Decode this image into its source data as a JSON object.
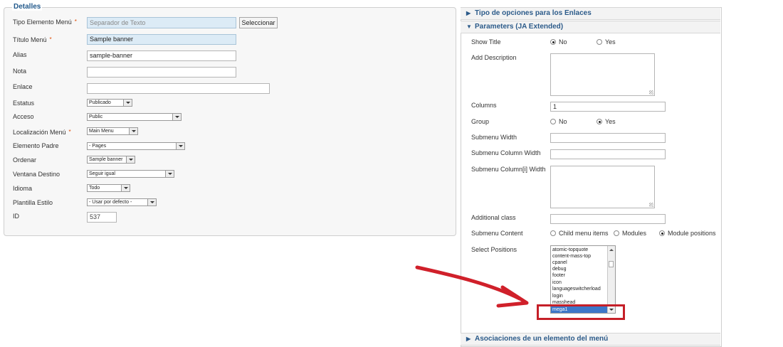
{
  "details": {
    "legend": "Detalles",
    "fields": [
      {
        "label": "Tipo Elemento Menú",
        "required": true,
        "value": "Separador de Texto"
      },
      {
        "label": "Título Menú",
        "required": true,
        "value": "Sample banner"
      },
      {
        "label": "Alias",
        "required": false,
        "value": "sample-banner"
      },
      {
        "label": "Nota",
        "required": false,
        "value": ""
      },
      {
        "label": "Enlace",
        "required": false,
        "value": ""
      },
      {
        "label": "Estatus",
        "required": false,
        "value": "Publicado"
      },
      {
        "label": "Acceso",
        "required": false,
        "value": "Public"
      },
      {
        "label": "Localización Menú",
        "required": true,
        "value": "Main Menu"
      },
      {
        "label": "Elemento Padre",
        "required": false,
        "value": "- Pages"
      },
      {
        "label": "Ordenar",
        "required": false,
        "value": "Sample banner"
      },
      {
        "label": "Ventana Destino",
        "required": false,
        "value": "Seguir igual"
      },
      {
        "label": "Idioma",
        "required": false,
        "value": "Todo"
      },
      {
        "label": "Plantilla Estilo",
        "required": false,
        "value": "- Usar por defecto -"
      },
      {
        "label": "ID",
        "required": false,
        "value": "537"
      }
    ],
    "select_button": "Seleccionar",
    "required_mark": "*"
  },
  "right": {
    "panes": [
      {
        "title": "Tipo de opciones para los Enlaces",
        "expanded": false
      },
      {
        "title": "Parameters (JA Extended)",
        "expanded": true
      },
      {
        "title": "Asociaciones de un elemento del menú",
        "expanded": false
      }
    ],
    "params": {
      "show_title": {
        "label": "Show Title",
        "options": [
          "No",
          "Yes"
        ],
        "selected": "No"
      },
      "add_description": {
        "label": "Add Description",
        "value": ""
      },
      "columns": {
        "label": "Columns",
        "value": "1"
      },
      "group": {
        "label": "Group",
        "options": [
          "No",
          "Yes"
        ],
        "selected": "Yes"
      },
      "submenu_width": {
        "label": "Submenu Width",
        "value": ""
      },
      "submenu_column_width": {
        "label": "Submenu Column Width",
        "value": ""
      },
      "submenu_columni_width": {
        "label": "Submenu Column[i] Width",
        "value": ""
      },
      "additional_class": {
        "label": "Additional class",
        "value": ""
      },
      "submenu_content": {
        "label": "Submenu Content",
        "options": [
          "Child menu items",
          "Modules",
          "Module positions"
        ],
        "selected": "Module positions"
      },
      "select_positions": {
        "label": "Select Positions",
        "items": [
          "atomic-topquote",
          "content-mass-top",
          "cpanel",
          "debug",
          "footer",
          "icon",
          "languageswitcherload",
          "login",
          "masshead",
          "mega1"
        ],
        "selected": "mega1"
      }
    }
  },
  "annotation": {
    "arrow_color": "#d0202a",
    "box_color": "#c51f28"
  },
  "colors": {
    "accent": "#2c5b8a",
    "highlight_field": "#dcebf6",
    "list_selection": "#3d77c8"
  }
}
